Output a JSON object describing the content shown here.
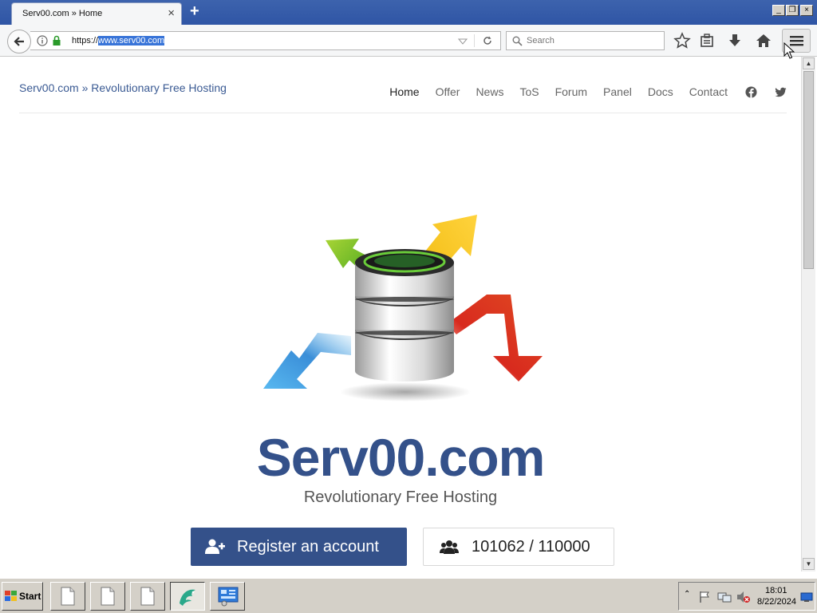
{
  "browser": {
    "tab_title": "Serv00.com » Home",
    "url_prefix": "https://",
    "url_highlight": "www.serv00.com",
    "search_placeholder": "Search"
  },
  "site": {
    "brand": "Serv00.com » Revolutionary Free Hosting",
    "nav": [
      {
        "label": "Home"
      },
      {
        "label": "Offer"
      },
      {
        "label": "News"
      },
      {
        "label": "ToS"
      },
      {
        "label": "Forum"
      },
      {
        "label": "Panel"
      },
      {
        "label": "Docs"
      },
      {
        "label": "Contact"
      }
    ],
    "hero_title": "Serv00.com",
    "hero_subtitle": "Revolutionary Free Hosting",
    "register_label": "Register an account",
    "counter_label": "101062 / 110000"
  },
  "taskbar": {
    "start_label": "Start",
    "time": "18:01",
    "date": "8/22/2024"
  },
  "colors": {
    "brand": "#34518a",
    "titlebar": "#3d63ad"
  }
}
